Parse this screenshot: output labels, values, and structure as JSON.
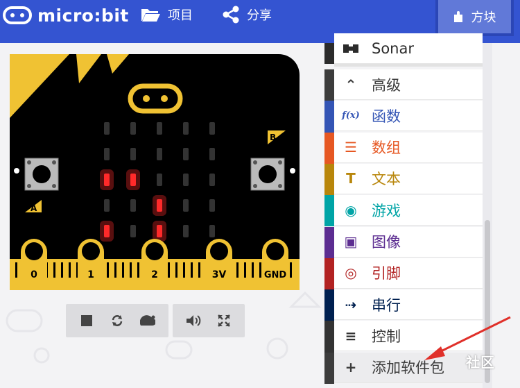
{
  "header": {
    "logo_text": "micro:bit",
    "nav": [
      {
        "label": "项目",
        "icon": "folder-open-icon"
      },
      {
        "label": "分享",
        "icon": "share-icon"
      }
    ],
    "blocks_tab_label": "方块",
    "blocks_tab_icon": "puzzle-piece-icon"
  },
  "simulator": {
    "pin_labels": [
      "0",
      "1",
      "2",
      "3V",
      "GND"
    ],
    "button_a_label": "A",
    "button_b_label": "B",
    "lit_leds": [
      [
        2,
        0
      ],
      [
        2,
        1
      ],
      [
        3,
        2
      ],
      [
        4,
        0
      ],
      [
        4,
        2
      ]
    ],
    "controls": [
      "stop-icon",
      "restart-icon",
      "slow-motion-icon",
      "mute-icon",
      "fullscreen-icon"
    ]
  },
  "toolbox": {
    "partial_item": {
      "label": "Sonar",
      "color": "#2b2b2b"
    },
    "items": [
      {
        "label": "高级",
        "color": "#3c3c3c",
        "icon": "chevron-up-icon",
        "glyph": "⌃"
      },
      {
        "label": "函数",
        "color": "#3455b5",
        "icon": "function-icon",
        "glyph": "f(x)"
      },
      {
        "label": "数组",
        "color": "#e65722",
        "icon": "list-icon",
        "glyph": "☰"
      },
      {
        "label": "文本",
        "color": "#b8860b",
        "icon": "text-icon",
        "glyph": "T"
      },
      {
        "label": "游戏",
        "color": "#00a4a6",
        "icon": "gamepad-icon",
        "glyph": "◉"
      },
      {
        "label": "图像",
        "color": "#5c2d91",
        "icon": "image-icon",
        "glyph": "▣"
      },
      {
        "label": "引脚",
        "color": "#b22222",
        "icon": "target-icon",
        "glyph": "◎"
      },
      {
        "label": "串行",
        "color": "#002050",
        "icon": "usb-icon",
        "glyph": "⇢"
      },
      {
        "label": "控制",
        "color": "#333333",
        "icon": "server-icon",
        "glyph": "≡"
      },
      {
        "label": "添加软件包",
        "color": "#3c3c3c",
        "icon": "plus-circle-icon",
        "glyph": "+"
      }
    ]
  },
  "watermark_text": "社区",
  "colors": {
    "header": "#3454d1",
    "board": "#000000",
    "edge": "#f0c233",
    "led_on": "#ff2a2a"
  }
}
